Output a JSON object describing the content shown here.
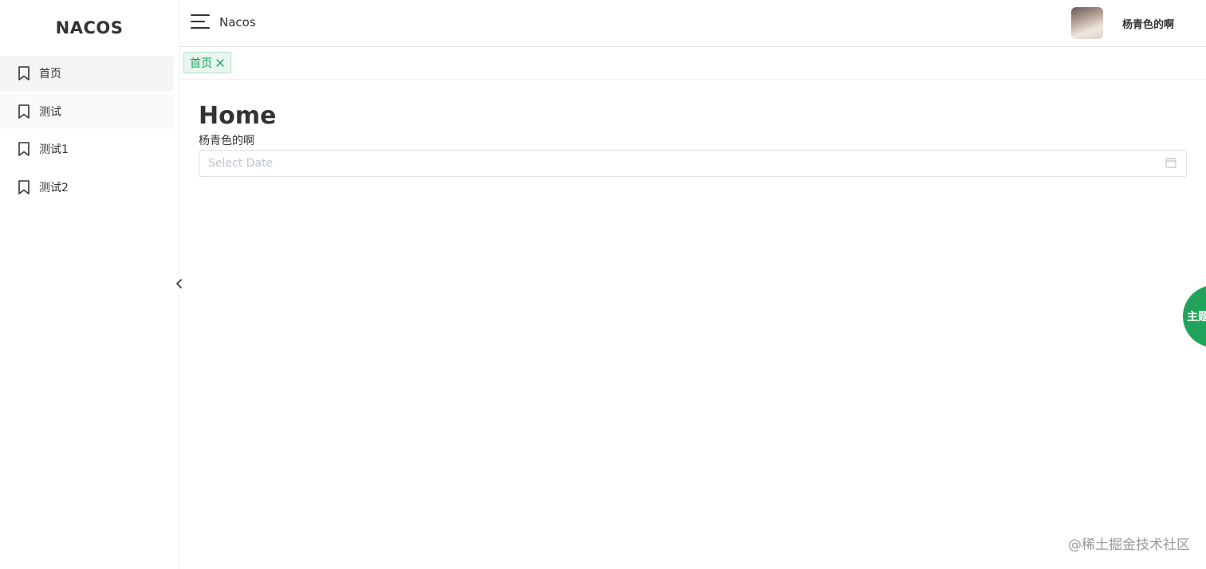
{
  "sidebar": {
    "logo": "NACOS",
    "items": [
      {
        "label": "首页",
        "icon": "bookmark-icon"
      },
      {
        "label": "测试",
        "icon": "bookmark-icon"
      },
      {
        "label": "测试1",
        "icon": "bookmark-icon"
      },
      {
        "label": "测试2",
        "icon": "bookmark-icon"
      }
    ],
    "collapse_icon": "chevron-left-icon"
  },
  "header": {
    "menu_icon": "hamburger-menu-icon",
    "brand": "Nacos",
    "username": "杨青色的啊"
  },
  "tabs": [
    {
      "label": "首页",
      "close_icon": "close-icon"
    }
  ],
  "main": {
    "title": "Home",
    "subtitle": "杨青色的啊",
    "date_input": {
      "placeholder": "Select Date",
      "icon": "calendar-icon"
    }
  },
  "theme_button": {
    "label": "主题"
  },
  "watermark": "@稀土掘金技术社区",
  "colors": {
    "accent": "#18a058",
    "theme_button_bg": "#22a35c"
  }
}
